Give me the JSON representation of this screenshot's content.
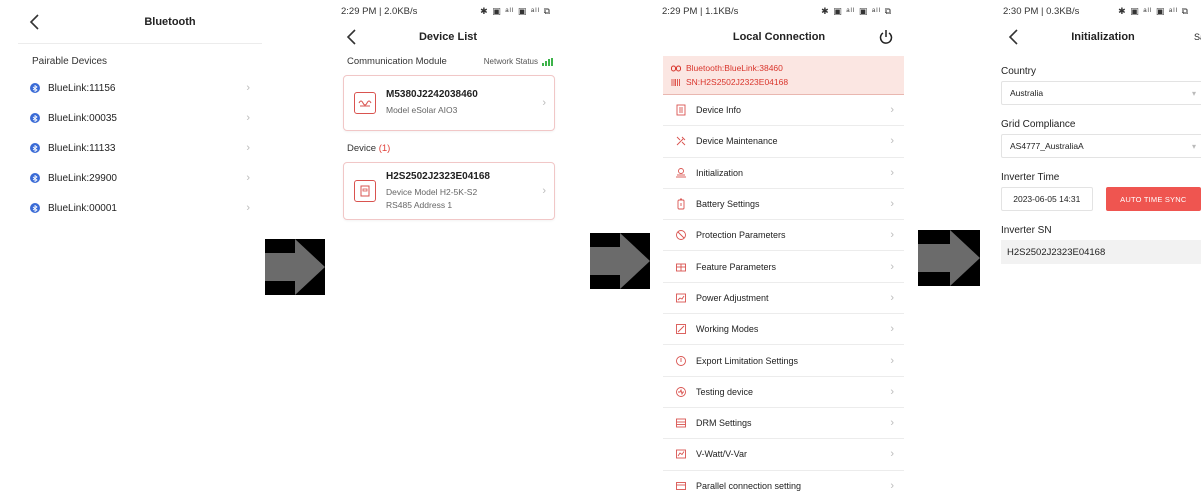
{
  "bluetooth": {
    "title": "Bluetooth",
    "section_label": "Pairable Devices",
    "devices": [
      {
        "name": "BlueLink:11156"
      },
      {
        "name": "BlueLink:00035"
      },
      {
        "name": "BlueLink:11133"
      },
      {
        "name": "BlueLink:29900"
      },
      {
        "name": "BlueLink:00001"
      }
    ]
  },
  "device_list": {
    "status_time": "2:29 PM | 2.0KB/s",
    "status_icons": "✱ ▣ ᵃˡˡ ▣ ᵃˡˡ ⧉",
    "title": "Device List",
    "comm_label": "Communication Module",
    "network_status": "Network Status",
    "module": {
      "title": "M5380J2242038460",
      "sub": "Model  eSolar AIO3"
    },
    "device_label": "Device",
    "device_count": "(1)",
    "device": {
      "title": "H2S2502J2323E04168",
      "model": "Device Model  H2-5K-S2",
      "address": "RS485 Address  1"
    }
  },
  "local_connection": {
    "status_time": "2:29 PM | 1.1KB/s",
    "status_icons": "✱ ▣ ᵃˡˡ ▣ ᵃˡˡ ⧉",
    "title": "Local Connection",
    "bluetooth_line": "Bluetooth:BlueLink:38460",
    "sn_line": "SN:H2S2502J2323E04168",
    "menu": [
      {
        "label": "Device Info",
        "icon": "device-info"
      },
      {
        "label": "Device Maintenance",
        "icon": "maintenance"
      },
      {
        "label": "Initialization",
        "icon": "initialization"
      },
      {
        "label": "Battery Settings",
        "icon": "battery"
      },
      {
        "label": "Protection Parameters",
        "icon": "protection"
      },
      {
        "label": "Feature Parameters",
        "icon": "feature"
      },
      {
        "label": "Power Adjustment",
        "icon": "power-adjust"
      },
      {
        "label": "Working Modes",
        "icon": "working-modes"
      },
      {
        "label": "Export Limitation Settings",
        "icon": "export-limit"
      },
      {
        "label": "Testing device",
        "icon": "testing"
      },
      {
        "label": "DRM Settings",
        "icon": "drm"
      },
      {
        "label": "V-Watt/V-Var",
        "icon": "v-watt"
      },
      {
        "label": "Parallel connection setting",
        "icon": "parallel"
      }
    ]
  },
  "initialization": {
    "status_time": "2:30 PM | 0.3KB/s",
    "status_icons": "✱ ▣ ᵃˡˡ ▣ ᵃˡˡ ⧉",
    "title": "Initialization",
    "save_label": "Sa",
    "country_label": "Country",
    "country_value": "Australia",
    "grid_label": "Grid Compliance",
    "grid_value": "AS4777_AustraliaA",
    "time_label": "Inverter Time",
    "time_value": "2023-06-05 14:31",
    "sync_label": "AUTO TIME SYNC",
    "sn_label": "Inverter SN",
    "sn_value": "H2S2502J2323E04168"
  },
  "colors": {
    "accent_red": "#ef5550",
    "bluetooth_blue": "#3a6bd6",
    "arrow_gray": "#6b6b6b"
  }
}
